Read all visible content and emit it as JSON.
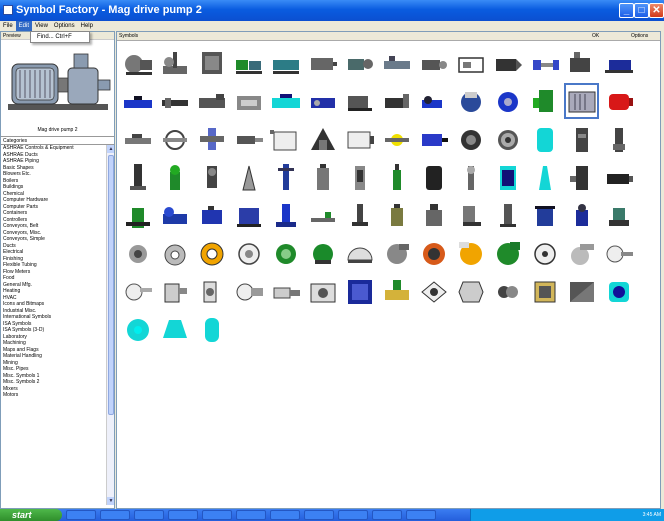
{
  "window": {
    "title": "Symbol Factory - Mag drive pump 2",
    "minimize": "_",
    "maximize": "□",
    "close": "✕"
  },
  "menu": [
    {
      "label": "File"
    },
    {
      "label": "Edit"
    },
    {
      "label": "View"
    },
    {
      "label": "Options"
    },
    {
      "label": "Help"
    }
  ],
  "dropdown": {
    "item": "Find...  Ctrl+F"
  },
  "preview": {
    "header": "Preview",
    "caption": "Mag drive pump 2"
  },
  "categories": {
    "header": "Categories",
    "items": [
      "ASHRAE Controls & Equipment",
      "ASHRAE Ducts",
      "ASHRAE Piping",
      "Basic Shapes",
      "Blowers Etc.",
      "Boilers",
      "Buildings",
      "Chemical",
      "Computer Hardware",
      "Computer Parts",
      "Containers",
      "Controllers",
      "Conveyors, Belt",
      "Conveyors, Misc.",
      "Conveyors, Simple",
      "Ducts",
      "Electrical",
      "Finishing",
      "Flexible Tubing",
      "Flow Meters",
      "Food",
      "General Mfg.",
      "Heating",
      "HVAC",
      "Icons and Bitmaps",
      "Industrial Misc.",
      "International Symbols",
      "ISA Symbols",
      "ISA Symbols (3-D)",
      "Laboratory",
      "Machining",
      "Maps and Flags",
      "Material Handling",
      "Mining",
      "Misc. Pipes",
      "Misc. Symbols 1",
      "Misc. Symbols 2",
      "Mixers",
      "Motors"
    ]
  },
  "symbols": {
    "header": "Symbols",
    "ok": "OK",
    "options": "Options",
    "selected_index": 26
  },
  "taskbar": {
    "start": "start",
    "tray_text": "3:45 AM"
  },
  "colors": {
    "accent": "#316ac5",
    "cyan": "#13d6d6",
    "orange": "#f1a400",
    "green": "#1f8a2a",
    "blue": "#1b36c8"
  }
}
